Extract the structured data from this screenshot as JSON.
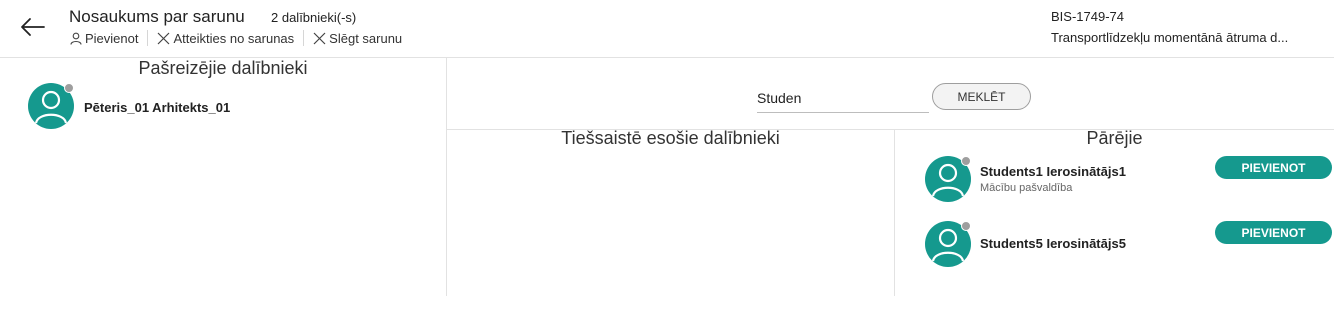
{
  "header": {
    "title": "Nosaukums par sarunu",
    "participant_count": "2 dalībnieki(-s)",
    "actions": {
      "add": "Pievienot",
      "leave": "Atteikties no sarunas",
      "close": "Slēgt sarunu"
    },
    "code": "BIS-1749-74",
    "description": "Transportlīdzekļu momentānā ātruma d..."
  },
  "current": {
    "title": "Pašreizējie dalībnieki",
    "participants": [
      {
        "name": "Pēteris_01 Arhitekts_01"
      }
    ]
  },
  "search": {
    "value": "Studen",
    "button": "MEKLĒT"
  },
  "online": {
    "title": "Tiešsaistē esošie dalībnieki"
  },
  "others": {
    "title": "Pārējie",
    "participants": [
      {
        "name": "Students1 Ierosinātājs1",
        "org": "Mācību pašvaldība",
        "button": "PIEVIENOT"
      },
      {
        "name": "Students5 Ierosinātājs5",
        "org": "",
        "button": "PIEVIENOT"
      }
    ]
  },
  "colors": {
    "accent": "#15998e",
    "status": "#9e9e9e"
  }
}
